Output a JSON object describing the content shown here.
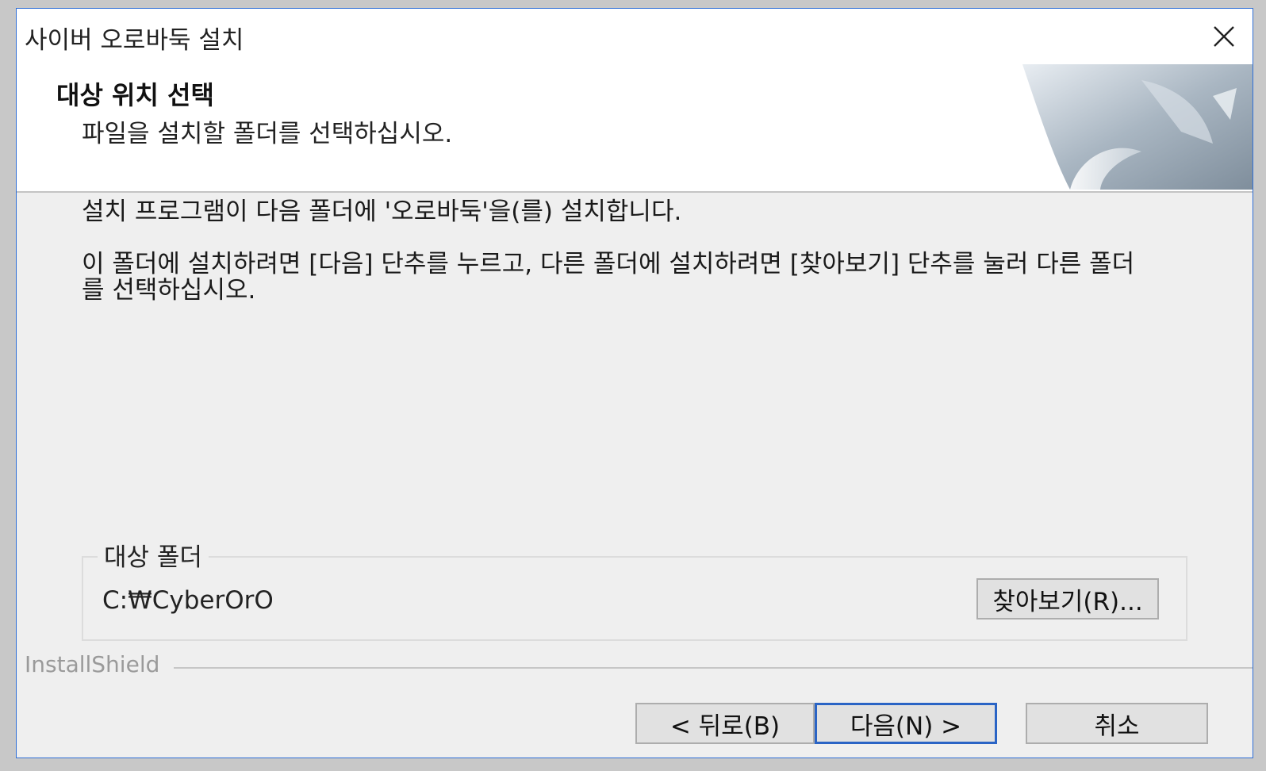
{
  "window": {
    "title": "사이버 오로바둑 설치"
  },
  "header": {
    "title": "대상 위치 선택",
    "subtitle": "파일을 설치할 폴더를 선택하십시오."
  },
  "body": {
    "line1": "설치 프로그램이 다음 폴더에 '오로바둑'을(를) 설치합니다.",
    "line2": "이 폴더에 설치하려면 [다음] 단추를 누르고, 다른 폴더에 설치하려면 [찾아보기] 단추를 눌러 다른 폴더를 선택하십시오."
  },
  "destination": {
    "legend": "대상 폴더",
    "path": "C:₩CyberOrO",
    "browse_label": "찾아보기(R)..."
  },
  "footer": {
    "brand": "InstallShield",
    "back_label": "< 뒤로(B)",
    "next_label": "다음(N) >",
    "cancel_label": "취소"
  },
  "colors": {
    "accent": "#2a64c5",
    "window_bg": "#efefef",
    "header_bg": "#ffffff"
  }
}
